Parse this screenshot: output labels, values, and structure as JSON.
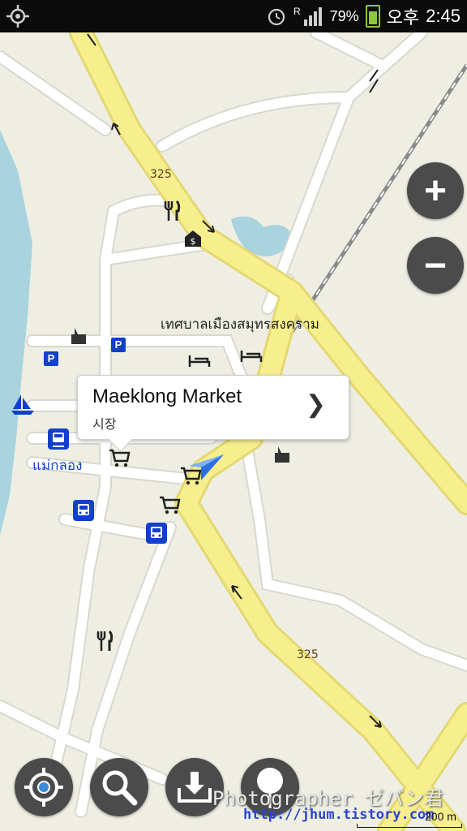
{
  "status_bar": {
    "signal_indicator": "R",
    "battery": "79%",
    "ampm": "오후",
    "time": "2:45",
    "icons": [
      "gps-icon",
      "alarm-icon",
      "signal-icon",
      "battery-icon"
    ]
  },
  "map": {
    "area_label": "เทศบาลเมืองสมุทรสงคราม",
    "station_label": "แม่กลอง",
    "route_numbers": [
      "325",
      "325"
    ],
    "colors": {
      "land": "#efeee3",
      "water": "#a9d3de",
      "major_road": "#f7ee8e",
      "major_road_edge": "#e3d872",
      "minor_road": "#ffffff",
      "poi_blue": "#1240c8"
    },
    "poi_icons": [
      "restaurant-icon",
      "bank-icon",
      "hotel-icon",
      "hotel-icon",
      "temple-icon",
      "temple-icon",
      "parking-icon",
      "parking-icon",
      "train-station-icon",
      "bus-stop-icon",
      "bus-stop-icon",
      "shopping-cart-icon",
      "shopping-cart-icon",
      "shopping-cart-icon",
      "boat-icon",
      "restaurant-icon",
      "current-location-arrow-icon"
    ]
  },
  "callout": {
    "title": "Maeklong Market",
    "subtitle": "시장",
    "chevron": "❯"
  },
  "zoom": {
    "in_label": "+",
    "out_label": "−"
  },
  "toolbar": {
    "buttons": [
      "my-location-icon",
      "search-icon",
      "download-icon",
      "place-pin-icon"
    ]
  },
  "watermark": {
    "text": "Photographer ゼバン君",
    "url": "http://jhum.tistory.com"
  },
  "scale": {
    "label": "200 m"
  }
}
